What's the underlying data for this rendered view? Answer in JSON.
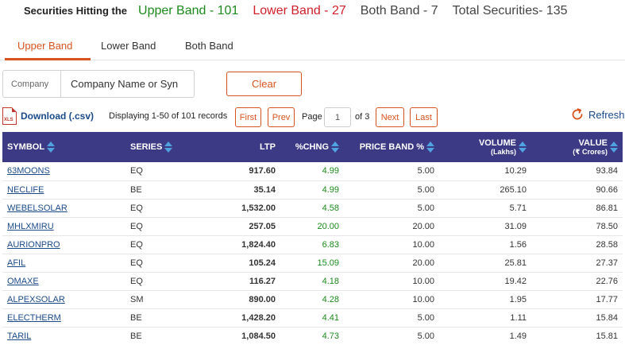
{
  "summary": {
    "lead": "Securities Hitting the",
    "upper": "Upper Band - 101",
    "lower": "Lower Band - 27",
    "both": "Both Band - 7",
    "total": "Total Securities- 135",
    "colors": {
      "upper": "#1c8a1c",
      "lower": "#d0202a"
    }
  },
  "tabs": [
    {
      "label": "Upper Band",
      "active": true
    },
    {
      "label": "Lower Band",
      "active": false
    },
    {
      "label": "Both Band",
      "active": false
    }
  ],
  "search": {
    "label": "Company",
    "placeholder": "Company Name or Syn"
  },
  "clear_label": "Clear",
  "download": {
    "icon": "xls-file-icon",
    "icon_text": "XLS",
    "label": "Download (.csv)"
  },
  "pagination": {
    "displaying": "Displaying 1-50 of 101 records",
    "first": "First",
    "prev": "Prev",
    "page_label": "Page",
    "page_value": "1",
    "of_label": "of 3",
    "next": "Next",
    "last": "Last"
  },
  "refresh": {
    "icon": "refresh-icon",
    "label": "Refresh"
  },
  "table": {
    "header_color": "#3c3a85",
    "columns": {
      "symbol": "SYMBOL",
      "series": "SERIES",
      "ltp": "LTP",
      "chng": "%CHNG",
      "band": "PRICE BAND %",
      "volume": "VOLUME",
      "volume_sub": "(Lakhs)",
      "value": "VALUE",
      "value_sub": "(₹ Crores)"
    },
    "rows": [
      {
        "symbol": "63MOONS",
        "series": "EQ",
        "ltp": "917.60",
        "chng": "4.99",
        "band": "5.00",
        "volume": "10.29",
        "value": "93.84"
      },
      {
        "symbol": "NECLIFE",
        "series": "BE",
        "ltp": "35.14",
        "chng": "4.99",
        "band": "5.00",
        "volume": "265.10",
        "value": "90.66"
      },
      {
        "symbol": "WEBELSOLAR",
        "series": "EQ",
        "ltp": "1,532.00",
        "chng": "4.58",
        "band": "5.00",
        "volume": "5.71",
        "value": "86.81"
      },
      {
        "symbol": "MHLXMIRU",
        "series": "EQ",
        "ltp": "257.05",
        "chng": "20.00",
        "band": "20.00",
        "volume": "31.09",
        "value": "78.50"
      },
      {
        "symbol": "AURIONPRO",
        "series": "EQ",
        "ltp": "1,824.40",
        "chng": "6.83",
        "band": "10.00",
        "volume": "1.56",
        "value": "28.58"
      },
      {
        "symbol": "AFIL",
        "series": "EQ",
        "ltp": "105.24",
        "chng": "15.09",
        "band": "20.00",
        "volume": "25.81",
        "value": "27.37"
      },
      {
        "symbol": "OMAXE",
        "series": "EQ",
        "ltp": "116.27",
        "chng": "4.18",
        "band": "10.00",
        "volume": "19.42",
        "value": "22.76"
      },
      {
        "symbol": "ALPEXSOLAR",
        "series": "SM",
        "ltp": "890.00",
        "chng": "4.28",
        "band": "10.00",
        "volume": "1.95",
        "value": "17.77"
      },
      {
        "symbol": "ELECTHERM",
        "series": "BE",
        "ltp": "1,428.20",
        "chng": "4.41",
        "band": "5.00",
        "volume": "1.11",
        "value": "15.84"
      },
      {
        "symbol": "TARIL",
        "series": "BE",
        "ltp": "1,084.50",
        "chng": "4.73",
        "band": "5.00",
        "volume": "1.49",
        "value": "15.81"
      }
    ]
  }
}
